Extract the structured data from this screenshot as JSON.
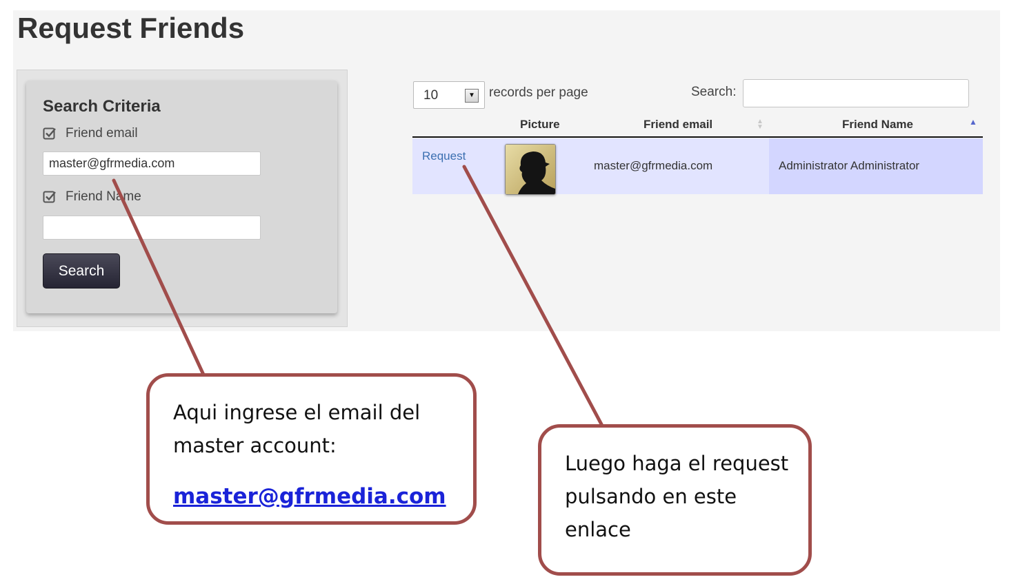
{
  "page": {
    "title": "Request Friends"
  },
  "search_criteria": {
    "title": "Search Criteria",
    "friend_email_label": "Friend email",
    "friend_email_value": "master@gfrmedia.com",
    "friend_name_label": "Friend Name",
    "friend_name_value": "",
    "search_button": "Search"
  },
  "table_controls": {
    "page_length": "10",
    "records_per_page_label": "records per page",
    "search_label": "Search:",
    "search_value": ""
  },
  "table": {
    "columns": [
      "Picture",
      "Friend email",
      "Friend Name"
    ],
    "rows": [
      {
        "action": "Request",
        "email": "master@gfrmedia.com",
        "name": "Administrator Administrator"
      }
    ]
  },
  "annotations": {
    "callout_1_text": "Aqui ingrese el email del master account:",
    "callout_1_link": "master@gfrmedia.com",
    "callout_2_text": "Luego haga el request pulsando en este enlace",
    "arrow_color": "#a14d4b"
  },
  "colors": {
    "row_highlight": "#e2e4ff",
    "sorted_column": "#d3d6ff",
    "link": "#3b6fb0",
    "button": "#2f2e3d"
  }
}
